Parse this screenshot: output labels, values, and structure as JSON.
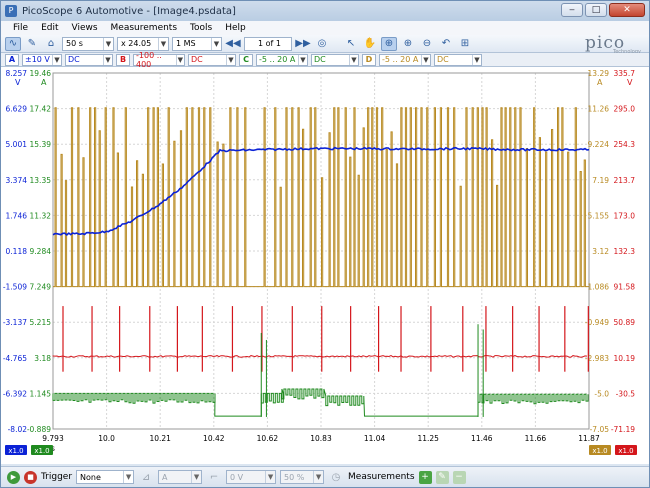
{
  "window": {
    "title": "PicoScope 6 Automotive - [Image4.psdata]",
    "minimize": "‒",
    "maximize": "□",
    "close": "✕"
  },
  "menu": [
    "File",
    "Edit",
    "Views",
    "Measurements",
    "Tools",
    "Help"
  ],
  "toolbar": {
    "timebase": "50 s",
    "zoom": "x 24.05",
    "samples": "1 MS",
    "buffer": "1 of 1"
  },
  "logo": {
    "text": "pico",
    "subtext": "Technology"
  },
  "channels": [
    {
      "letter": "A",
      "color": "#0b22d6",
      "range": "±10 V",
      "coupling": "DC"
    },
    {
      "letter": "B",
      "color": "#d4161b",
      "range": "-100 .. 400",
      "coupling": "DC"
    },
    {
      "letter": "C",
      "color": "#1f8a1f",
      "range": "-5 .. 20 A",
      "coupling": "DC"
    },
    {
      "letter": "D",
      "color": "#b88a22",
      "range": "-5 .. 20 A",
      "coupling": "DC"
    }
  ],
  "status": {
    "trigger_label": "Trigger",
    "trigger_value": "None",
    "channel_value": "A",
    "level_value": "0 V",
    "percent_value": "50 %",
    "measurements_label": "Measurements"
  },
  "chart_data": {
    "type": "line",
    "x_ticks": [
      "9.793",
      "10.0",
      "10.21",
      "10.42",
      "10.62",
      "10.83",
      "11.04",
      "11.25",
      "11.46",
      "11.66",
      "11.87"
    ],
    "x_unit": "s",
    "xlim": [
      9.793,
      11.87
    ],
    "axis_A": {
      "unit": "V",
      "ticks": [
        "8.257",
        "6.629",
        "5.001",
        "3.374",
        "1.746",
        "0.118",
        "-1.509",
        "-3.137",
        "-4.765",
        "-6.392",
        "-8.02"
      ],
      "color": "#0b22d6"
    },
    "axis_C": {
      "unit": "A",
      "ticks": [
        "19.46",
        "17.42",
        "15.39",
        "13.35",
        "11.32",
        "9.284",
        "7.249",
        "5.215",
        "3.18",
        "1.145",
        "-0.889"
      ],
      "color": "#1f8a1f"
    },
    "axis_D": {
      "unit": "A",
      "ticks": [
        "13.29",
        "11.26",
        "9.224",
        "7.19",
        "5.155",
        "3.12",
        "1.086",
        "-0.949",
        "-2.983",
        "-5.0",
        "-7.05"
      ],
      "color": "#b88a22"
    },
    "axis_B": {
      "unit": "V",
      "ticks": [
        "335.7",
        "295.0",
        "254.3",
        "213.7",
        "173.0",
        "132.3",
        "91.58",
        "50.89",
        "10.19",
        "-30.5",
        "-71.19"
      ],
      "color": "#d4161b"
    },
    "series": [
      {
        "channel": "A",
        "color": "#0b22d6",
        "points": [
          [
            9.793,
            0.9
          ],
          [
            9.9,
            0.9
          ],
          [
            10.0,
            1.0
          ],
          [
            10.1,
            1.5
          ],
          [
            10.2,
            2.2
          ],
          [
            10.3,
            3.1
          ],
          [
            10.38,
            4.0
          ],
          [
            10.44,
            4.7
          ],
          [
            10.6,
            4.75
          ],
          [
            10.8,
            4.8
          ],
          [
            11.0,
            4.8
          ],
          [
            11.2,
            4.78
          ],
          [
            11.4,
            4.8
          ],
          [
            11.6,
            4.75
          ],
          [
            11.87,
            4.75
          ]
        ]
      },
      {
        "channel": "B",
        "color": "#d4161b",
        "baseline": -4.7,
        "spike_top": -2.4,
        "spike_bottom": -5.4
      },
      {
        "channel": "C",
        "color": "#1f8a1f",
        "segments": [
          [
            9.793,
            10.42,
            1.145,
            1.145
          ],
          [
            10.42,
            10.6,
            -0.15,
            -0.15
          ],
          [
            10.6,
            10.68,
            1.145,
            1.145
          ],
          [
            10.68,
            10.85,
            1.4,
            1.4
          ],
          [
            10.85,
            11.0,
            1.0,
            1.0
          ],
          [
            11.0,
            11.44,
            -0.15,
            -0.15
          ],
          [
            11.44,
            11.87,
            1.1,
            1.1
          ]
        ]
      },
      {
        "channel": "D",
        "color": "#b88a22",
        "baseline": 1.086,
        "pulse_top": 11.3
      }
    ]
  }
}
